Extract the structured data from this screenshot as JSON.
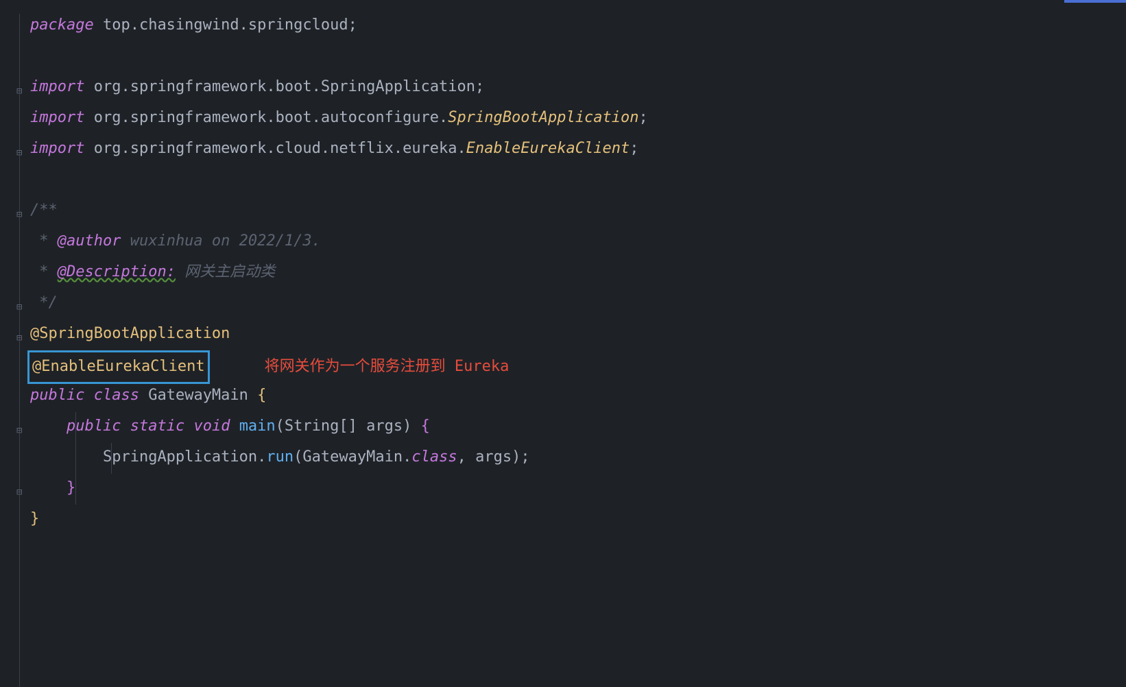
{
  "code": {
    "package_kw": "package",
    "package_name": "top.chasingwind.springcloud",
    "import_kw": "import",
    "import1_pkg": "org.springframework.boot.",
    "import1_class": "SpringApplication",
    "import2_pkg": "org.springframework.boot.autoconfigure.",
    "import2_class": "SpringBootApplication",
    "import3_pkg": "org.springframework.cloud.netflix.eureka.",
    "import3_class": "EnableEurekaClient",
    "doc_open": "/**",
    "doc_star": " * ",
    "doc_author_tag": "@author",
    "doc_author_text": " wuxinhua on 2022/1/3.",
    "doc_desc_tag": "@Description:",
    "doc_desc_text": " 网关主启动类",
    "doc_close": " */",
    "annotation1": "@SpringBootApplication",
    "annotation2": "@EnableEurekaClient",
    "red_comment": "将网关作为一个服务注册到 Eureka",
    "public_kw": "public",
    "class_kw": "class",
    "class_name": "GatewayMain",
    "static_kw": "static",
    "void_kw": "void",
    "main_method": "main",
    "main_param_type": "String[]",
    "main_param_name": "args",
    "spring_app": "SpringApplication",
    "run_method": "run",
    "gateway_ref": "GatewayMain",
    "class_ref": "class",
    "args_ref": "args",
    "semicolon": ";",
    "open_brace": "{",
    "close_brace": "}",
    "open_paren": "(",
    "close_paren": ")",
    "comma": ", ",
    "dot": "."
  }
}
